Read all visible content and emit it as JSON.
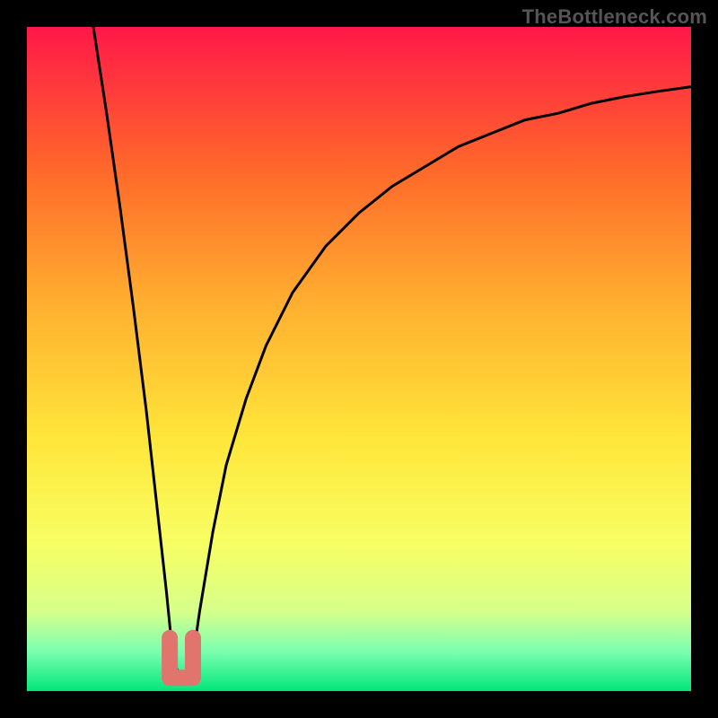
{
  "watermark": "TheBottleneck.com",
  "colors": {
    "frame": "#000000",
    "gradient_top": "#ff1848",
    "gradient_mid1": "#ff6a2a",
    "gradient_mid2": "#ffb030",
    "gradient_mid3": "#ffe63a",
    "gradient_mid4": "#f7ff64",
    "gradient_mid5": "#d6ff8a",
    "gradient_mid6": "#7cffb0",
    "gradient_bottom": "#00e67a",
    "curve": "#000000",
    "marker": "#e2746e"
  },
  "chart_data": {
    "type": "line",
    "title": "",
    "xlabel": "",
    "ylabel": "",
    "xlim": [
      0,
      100
    ],
    "ylim": [
      0,
      100
    ],
    "note": "V-shaped bottleneck curve. Values estimated from pixel position; y is approximate bottleneck %. Minimum near x≈23.",
    "series": [
      {
        "name": "bottleneck-curve",
        "x": [
          10,
          12,
          14,
          16,
          18,
          20,
          21,
          22,
          23,
          24,
          25,
          26,
          28,
          30,
          33,
          36,
          40,
          45,
          50,
          55,
          60,
          65,
          70,
          75,
          80,
          85,
          90,
          95,
          100
        ],
        "y": [
          100,
          87,
          73,
          58,
          42,
          24,
          15,
          5,
          2,
          2,
          5,
          12,
          24,
          34,
          44,
          52,
          60,
          67,
          72,
          76,
          79,
          82,
          84,
          86,
          87,
          88.5,
          89.5,
          90.3,
          91
        ]
      }
    ],
    "marker": {
      "name": "optimum-region",
      "shape": "u",
      "x_range": [
        21.5,
        25
      ],
      "y_range": [
        2,
        8
      ]
    }
  }
}
